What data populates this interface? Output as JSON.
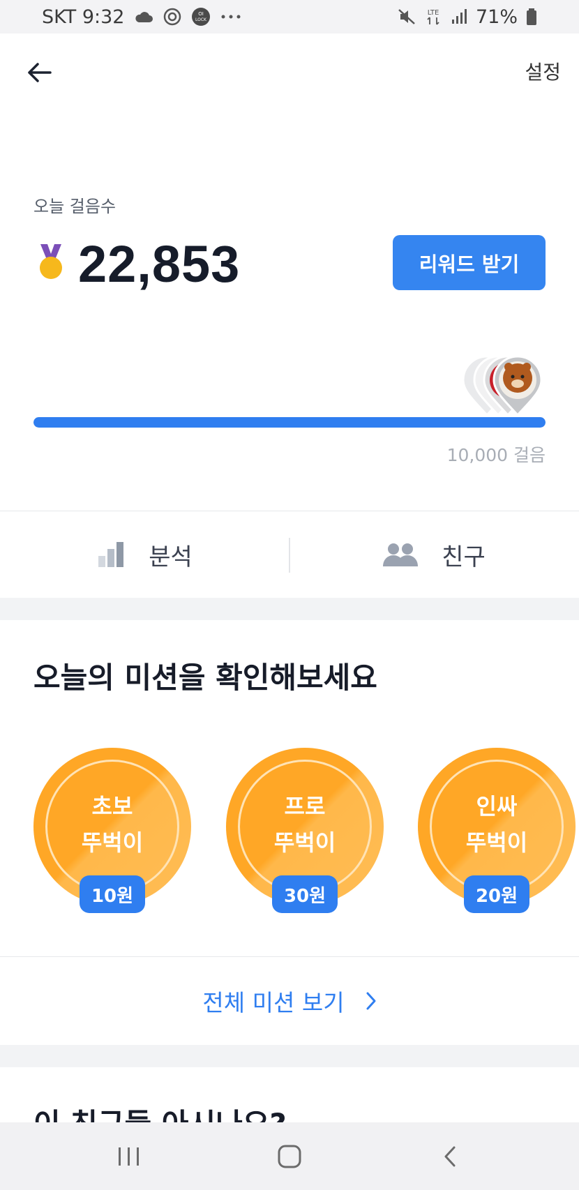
{
  "status_bar": {
    "carrier_time": "SKT 9:32",
    "icons_left": [
      "cloud-icon",
      "target-icon",
      "lock-badge-icon",
      "more-dots-icon"
    ],
    "lock_badge_text": "OI LOCK",
    "network": "LTE",
    "battery": "71%",
    "icons_right": [
      "mute-icon",
      "lte-icon",
      "signal-icon",
      "battery-icon"
    ]
  },
  "header": {
    "back_icon": "arrow-left-icon",
    "settings_label": "설정"
  },
  "steps": {
    "label": "오늘 걸음수",
    "value": "22,853",
    "reward_button": "리워드 받기",
    "goal_label": "10,000 걸음",
    "progress_fraction": 1.0
  },
  "tabs": [
    {
      "label": "분석",
      "icon": "bar-chart-icon"
    },
    {
      "label": "친구",
      "icon": "people-icon"
    }
  ],
  "missions": {
    "title": "오늘의 미션을 확인해보세요",
    "items": [
      {
        "line1": "초보",
        "line2": "뚜벅이",
        "reward": "10원"
      },
      {
        "line1": "프로",
        "line2": "뚜벅이",
        "reward": "30원"
      },
      {
        "line1": "인싸",
        "line2": "뚜벅이",
        "reward": "20원"
      }
    ],
    "view_all": "전체 미션 보기"
  },
  "friends_section": {
    "title": "이 친구들 아시나요?"
  },
  "nav": {
    "buttons": [
      "recent-apps-icon",
      "home-icon",
      "back-nav-icon"
    ]
  },
  "colors": {
    "accent": "#2f7ef0",
    "mission_orange": "#ffa726"
  }
}
